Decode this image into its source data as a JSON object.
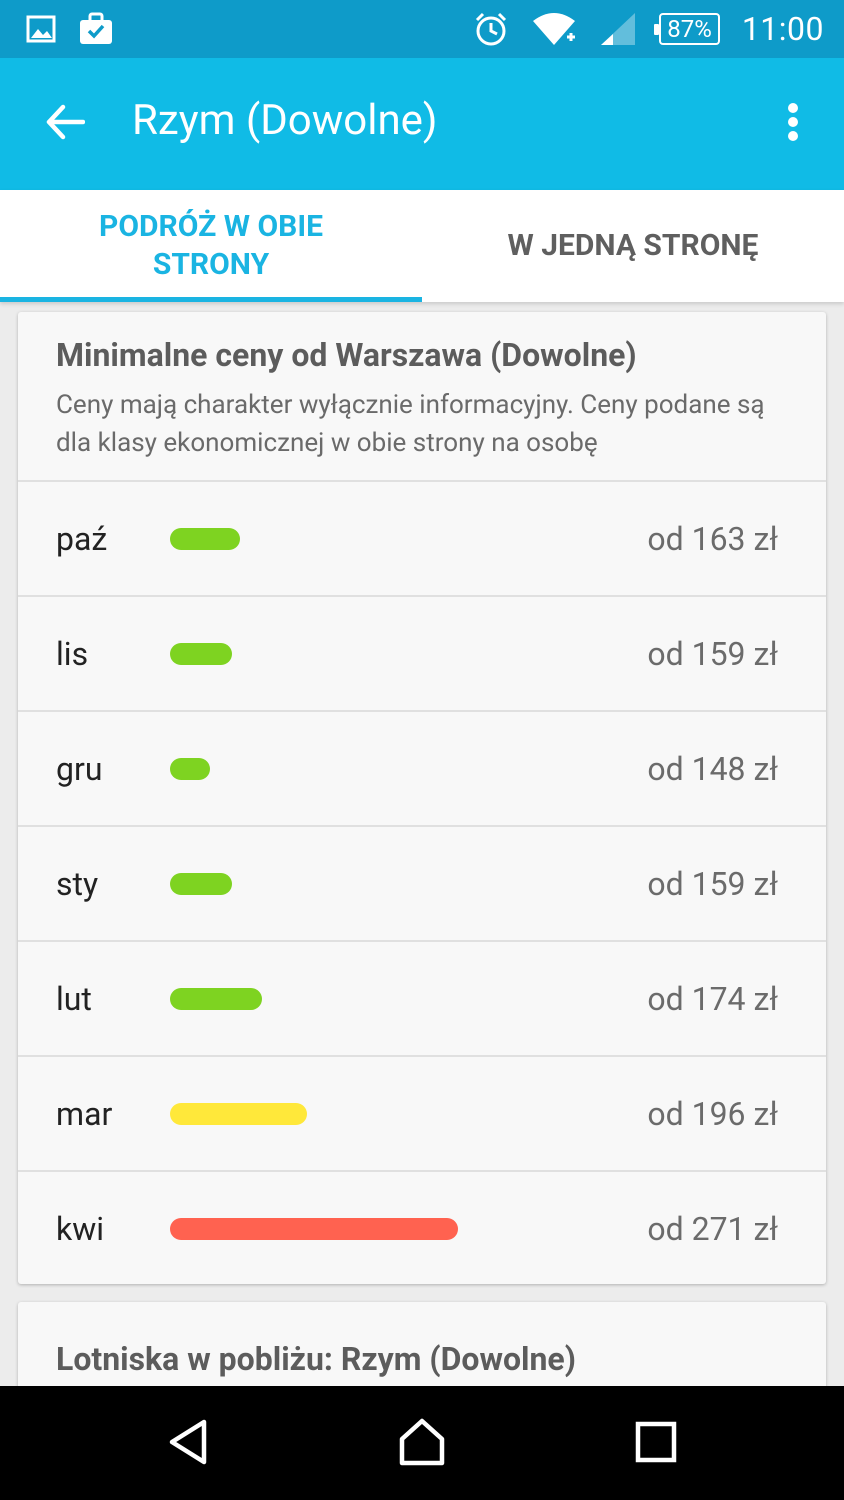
{
  "status_bar": {
    "icons_left": [
      "gallery-icon",
      "briefcase-check-icon"
    ],
    "icons_right": [
      "alarm-icon",
      "wifi-icon",
      "signal-icon"
    ],
    "battery": "87%",
    "time": "11:00"
  },
  "app_bar": {
    "title": "Rzym (Dowolne)",
    "back_icon": "arrow-back-icon",
    "menu_icon": "more-vert-icon"
  },
  "tabs": [
    {
      "label": "PODRÓŻ W OBIE STRONY",
      "active": true
    },
    {
      "label": "W JEDNĄ STRONĘ",
      "active": false
    }
  ],
  "price_card": {
    "title": "Minimalne ceny od Warszawa (Dowolne)",
    "description": "Ceny mają charakter wyłącznie informacyjny. Ceny podane są dla klasy ekonomicznej w obie strony na osobę",
    "rows": [
      {
        "month": "paź",
        "price": "od 163 zł",
        "value": 163,
        "color": "#7ed321"
      },
      {
        "month": "lis",
        "price": "od 159 zł",
        "value": 159,
        "color": "#7ed321"
      },
      {
        "month": "gru",
        "price": "od 148 zł",
        "value": 148,
        "color": "#7ed321"
      },
      {
        "month": "sty",
        "price": "od 159 zł",
        "value": 159,
        "color": "#7ed321"
      },
      {
        "month": "lut",
        "price": "od 174 zł",
        "value": 174,
        "color": "#7ed321"
      },
      {
        "month": "mar",
        "price": "od 196 zł",
        "value": 196,
        "color": "#ffe83a"
      },
      {
        "month": "kwi",
        "price": "od 271 zł",
        "value": 271,
        "color": "#ff6250"
      }
    ]
  },
  "airports_card": {
    "title": "Lotniska w pobliżu: Rzym (Dowolne)"
  },
  "nav_bar": {
    "buttons": [
      "back-triangle-icon",
      "home-icon",
      "recents-icon"
    ]
  },
  "colors": {
    "status_bar": "#0e9bc9",
    "app_bar": "#10bbe6",
    "accent": "#1ab4e2"
  }
}
